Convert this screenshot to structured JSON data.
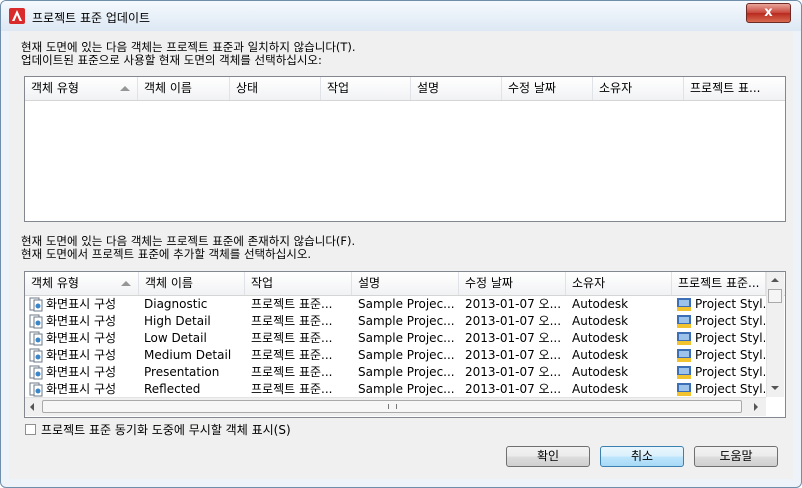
{
  "window": {
    "title": "프로젝트 표준 업데이트",
    "close": "x"
  },
  "top_description": [
    "현재 도면에 있는 다음 객체는 프로젝트 표준과 일치하지 않습니다(T).",
    "업데이트된 표준으로 사용할 현재 도면의 객체를 선택하십시오:"
  ],
  "top_table": {
    "headers": [
      "객체 유형",
      "객체 이름",
      "상태",
      "작업",
      "설명",
      "수정 날짜",
      "소유자",
      "프로젝트 표..."
    ]
  },
  "bottom_description": [
    "현재 도면에 있는 다음 객체는 프로젝트 표준에 존재하지 않습니다(F).",
    "현재 도면에서 프로젝트 표준에 추가할 객체를 선택하십시오."
  ],
  "bottom_table": {
    "headers": [
      "객체 유형",
      "객체 이름",
      "작업",
      "설명",
      "수정 날짜",
      "소유자",
      "프로젝트 표준..."
    ],
    "rows": [
      {
        "type": "화면표시 구성",
        "name": "Diagnostic",
        "action": "프로젝트 표준...",
        "desc": "Sample Projec...",
        "date": "2013-01-07 오...",
        "owner": "Autodesk",
        "std": "Project Styl..."
      },
      {
        "type": "화면표시 구성",
        "name": "High Detail",
        "action": "프로젝트 표준...",
        "desc": "Sample Projec...",
        "date": "2013-01-07 오...",
        "owner": "Autodesk",
        "std": "Project Styl..."
      },
      {
        "type": "화면표시 구성",
        "name": "Low Detail",
        "action": "프로젝트 표준...",
        "desc": "Sample Projec...",
        "date": "2013-01-07 오...",
        "owner": "Autodesk",
        "std": "Project Styl..."
      },
      {
        "type": "화면표시 구성",
        "name": "Medium Detail",
        "action": "프로젝트 표준...",
        "desc": "Sample Projec...",
        "date": "2013-01-07 오...",
        "owner": "Autodesk",
        "std": "Project Styl..."
      },
      {
        "type": "화면표시 구성",
        "name": "Presentation",
        "action": "프로젝트 표준...",
        "desc": "Sample Projec...",
        "date": "2013-01-07 오...",
        "owner": "Autodesk",
        "std": "Project Styl..."
      },
      {
        "type": "화면표시 구성",
        "name": "Reflected",
        "action": "프로젝트 표준...",
        "desc": "Sample Projec...",
        "date": "2013-01-07 오...",
        "owner": "Autodesk",
        "std": "Project Styl..."
      }
    ]
  },
  "checkbox": {
    "label": "프로젝트 표준 동기화 도중에 무시할 객체 표시(S)",
    "checked": false
  },
  "buttons": {
    "ok": "확인",
    "cancel": "취소",
    "help": "도움말"
  },
  "colors": {
    "accent": "#3c7fb1",
    "close": "#c8453a",
    "app_icon": "#d92b2b"
  }
}
